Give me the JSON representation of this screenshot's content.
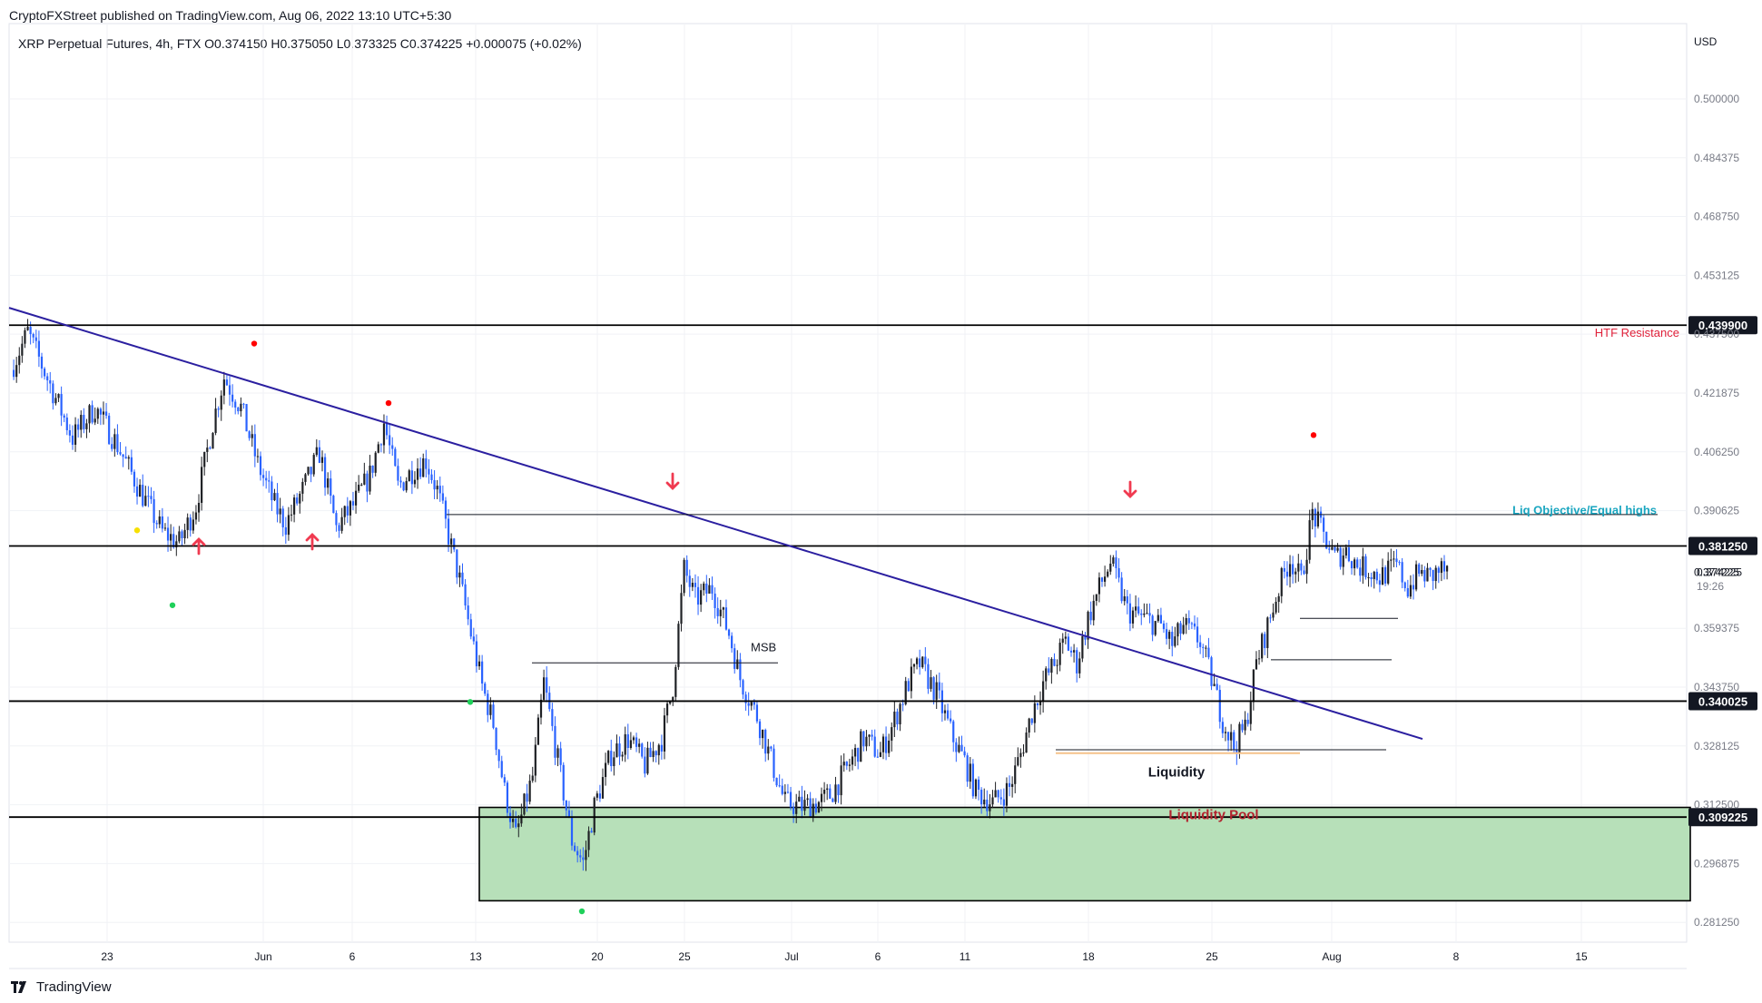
{
  "header": {
    "publisher": "CryptoFXStreet published on TradingView.com, Aug 06, 2022 13:10 UTC+5:30",
    "legend": "XRP Perpetual Futures, 4h, FTX  O0.374150  H0.375050  L0.373325  C0.374225  +0.000075 (+0.02%)"
  },
  "footer": {
    "brand": "TradingView"
  },
  "colors": {
    "bull": "#1f2125",
    "bear": "#2962ff",
    "trendline": "#2b1fa0",
    "zone_fill": "#b7e0b9",
    "resistance_label": "#e0213a",
    "liq_label": "#1aa6c0",
    "pool_label": "#b2232f"
  },
  "chart_data": {
    "type": "candlestick",
    "symbol": "XRP Perpetual Futures",
    "timeframe": "4h",
    "exchange": "FTX",
    "currency": "USD",
    "ylim": [
      0.276,
      0.52
    ],
    "y_ticks": [
      "0.500000",
      "0.484375",
      "0.468750",
      "0.453125",
      "0.437500",
      "0.421875",
      "0.406250",
      "0.390625",
      "0.374225",
      "0.359375",
      "0.343750",
      "0.328125",
      "0.312500",
      "0.296875",
      "0.281250"
    ],
    "x_ticks": [
      "23",
      "Jun",
      "6",
      "13",
      "20",
      "25",
      "Jul",
      "6",
      "11",
      "18",
      "25",
      "Aug",
      "8",
      "15"
    ],
    "last_price": "0.374225",
    "countdown": "19:26",
    "path": [
      [
        0.428,
        0
      ],
      [
        0.438,
        6
      ],
      [
        0.424,
        14
      ],
      [
        0.41,
        22
      ],
      [
        0.418,
        30
      ],
      [
        0.408,
        38
      ],
      [
        0.396,
        46
      ],
      [
        0.385,
        54
      ],
      [
        0.382,
        60
      ],
      [
        0.392,
        66
      ],
      [
        0.414,
        72
      ],
      [
        0.426,
        76
      ],
      [
        0.418,
        82
      ],
      [
        0.403,
        88
      ],
      [
        0.392,
        94
      ],
      [
        0.387,
        98
      ],
      [
        0.396,
        104
      ],
      [
        0.406,
        110
      ],
      [
        0.386,
        116
      ],
      [
        0.392,
        122
      ],
      [
        0.4,
        128
      ],
      [
        0.414,
        133
      ],
      [
        0.397,
        138
      ],
      [
        0.402,
        144
      ],
      [
        0.404,
        148
      ],
      [
        0.396,
        152
      ],
      [
        0.384,
        156
      ],
      [
        0.372,
        160
      ],
      [
        0.358,
        164
      ],
      [
        0.344,
        168
      ],
      [
        0.334,
        172
      ],
      [
        0.316,
        176
      ],
      [
        0.304,
        180
      ],
      [
        0.32,
        186
      ],
      [
        0.345,
        190
      ],
      [
        0.32,
        196
      ],
      [
        0.303,
        200
      ],
      [
        0.297,
        204
      ],
      [
        0.312,
        208
      ],
      [
        0.326,
        214
      ],
      [
        0.33,
        220
      ],
      [
        0.323,
        226
      ],
      [
        0.33,
        232
      ],
      [
        0.344,
        236
      ],
      [
        0.375,
        240
      ],
      [
        0.367,
        244
      ],
      [
        0.37,
        250
      ],
      [
        0.358,
        256
      ],
      [
        0.346,
        260
      ],
      [
        0.336,
        266
      ],
      [
        0.322,
        272
      ],
      [
        0.313,
        276
      ],
      [
        0.312,
        282
      ],
      [
        0.313,
        288
      ],
      [
        0.315,
        292
      ],
      [
        0.322,
        298
      ],
      [
        0.33,
        304
      ],
      [
        0.326,
        310
      ],
      [
        0.333,
        314
      ],
      [
        0.345,
        320
      ],
      [
        0.35,
        324
      ],
      [
        0.342,
        330
      ],
      [
        0.33,
        336
      ],
      [
        0.324,
        340
      ],
      [
        0.316,
        344
      ],
      [
        0.313,
        350
      ],
      [
        0.317,
        356
      ],
      [
        0.326,
        360
      ],
      [
        0.337,
        364
      ],
      [
        0.345,
        368
      ],
      [
        0.35,
        372
      ],
      [
        0.356,
        376
      ],
      [
        0.35,
        380
      ],
      [
        0.362,
        384
      ],
      [
        0.37,
        388
      ],
      [
        0.377,
        392
      ],
      [
        0.364,
        398
      ],
      [
        0.362,
        404
      ],
      [
        0.36,
        410
      ],
      [
        0.355,
        414
      ],
      [
        0.36,
        418
      ],
      [
        0.356,
        424
      ],
      [
        0.346,
        428
      ],
      [
        0.335,
        432
      ],
      [
        0.328,
        436
      ],
      [
        0.333,
        440
      ],
      [
        0.35,
        444
      ],
      [
        0.36,
        448
      ],
      [
        0.37,
        452
      ],
      [
        0.378,
        456
      ],
      [
        0.372,
        460
      ],
      [
        0.39,
        464
      ],
      [
        0.384,
        468
      ],
      [
        0.378,
        472
      ],
      [
        0.38,
        476
      ],
      [
        0.376,
        480
      ],
      [
        0.375,
        484
      ],
      [
        0.373,
        488
      ],
      [
        0.376,
        494
      ],
      [
        0.37,
        498
      ],
      [
        0.374,
        502
      ],
      [
        0.373,
        506
      ],
      [
        0.375,
        510
      ],
      [
        0.374,
        512
      ]
    ],
    "levels": [
      {
        "value": "0.439900",
        "label": "HTF Resistance"
      },
      {
        "value": "0.381250",
        "label": ""
      },
      {
        "value": "0.340025",
        "label": ""
      },
      {
        "value": "0.309225",
        "label": "Liquidity Pool"
      }
    ],
    "annotations": {
      "msb": "MSB",
      "liq_objective": "Liq Objective/Equal highs",
      "liquidity": "Liquidity",
      "liquidity_pool": "Liquidity Pool",
      "htf_resistance": "HTF Resistance"
    }
  }
}
